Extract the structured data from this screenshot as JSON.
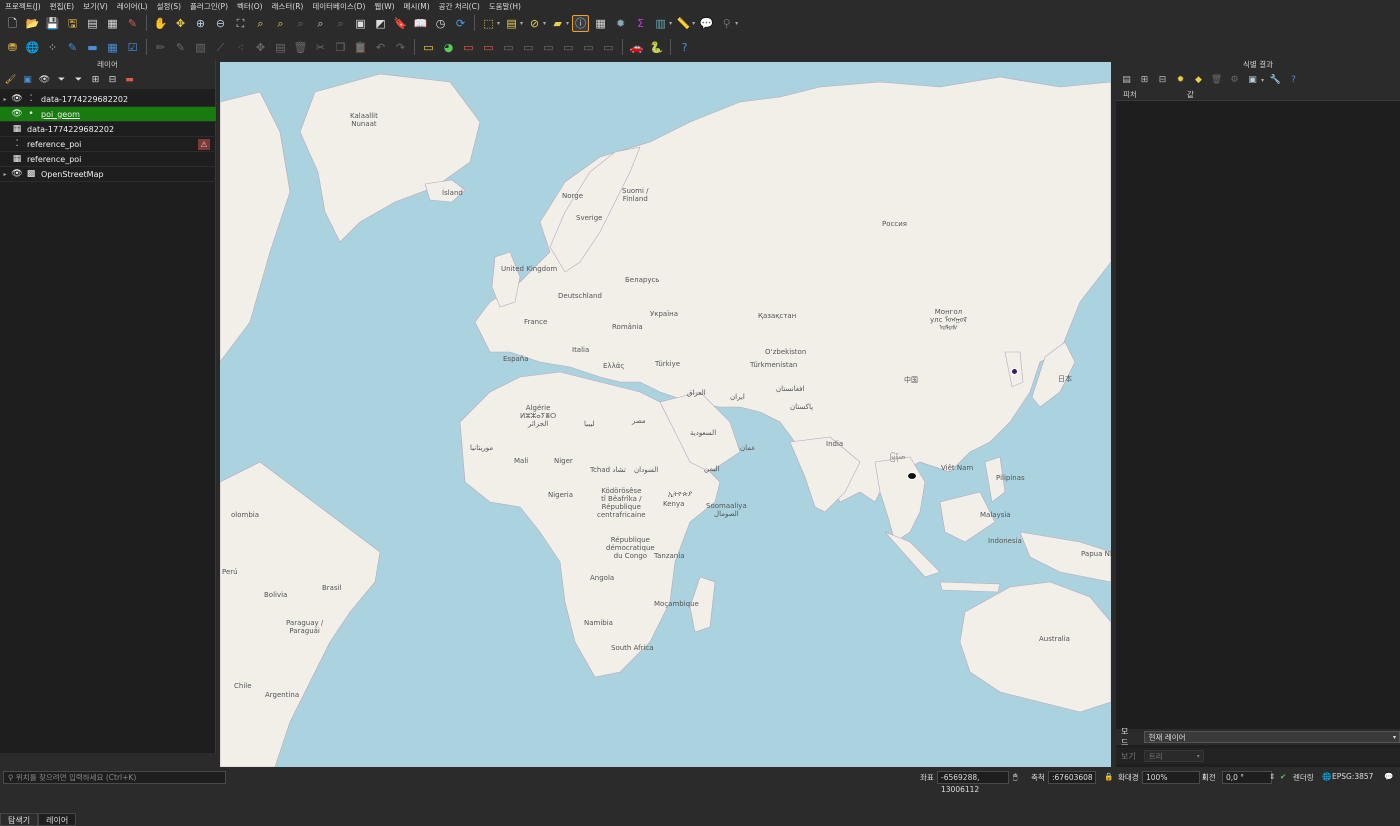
{
  "menu": [
    "프로젝트(J)",
    "편집(E)",
    "보기(V)",
    "레이어(L)",
    "설정(S)",
    "플러그인(P)",
    "벡터(O)",
    "래스터(R)",
    "데이터베이스(D)",
    "웹(W)",
    "메시(M)",
    "공간 처리(C)",
    "도움말(H)"
  ],
  "layers_panel": {
    "title": "레이어",
    "layers": [
      {
        "name": "data-1774229682202",
        "expandable": true,
        "visible": true,
        "icon": "points-icon",
        "selected": false,
        "warning": false
      },
      {
        "name": "poi_geom",
        "expandable": false,
        "visible": true,
        "icon": "point-icon",
        "selected": true,
        "warning": false
      },
      {
        "name": "data-1774229682202",
        "expandable": false,
        "visible": null,
        "icon": "table-icon",
        "selected": false,
        "warning": false
      },
      {
        "name": "reference_poi",
        "expandable": false,
        "visible": null,
        "icon": "points-icon",
        "selected": false,
        "warning": true
      },
      {
        "name": "reference_poi",
        "expandable": false,
        "visible": null,
        "icon": "table-icon",
        "selected": false,
        "warning": false
      },
      {
        "name": "OpenStreetMap",
        "expandable": true,
        "visible": true,
        "icon": "xyz-tiles-icon",
        "selected": false,
        "warning": false
      }
    ],
    "tabs": [
      "탐색기",
      "레이어"
    ],
    "active_tab": "레이어"
  },
  "map": {
    "labels": {
      "greenland": "Kalaallit\nNunaat",
      "iceland": "Ísland",
      "norway": "Norge",
      "sweden": "Sverige",
      "finland": "Suomi /\nFinland",
      "russia": "Россия",
      "uk": "United Kingdom",
      "belarus": "Беларусь",
      "germany": "Deutschland",
      "ukraine": "Україна",
      "france": "France",
      "romania": "România",
      "kazakhstan": "Қазақстан",
      "mongolia": "Монгол\nулс ᠮᠤᠩᠭᠤᠯ\nᠤᠯᠤᠰ",
      "spain": "España",
      "italy": "Italia",
      "greece": "Ελλάς",
      "turkey": "Türkiye",
      "uzbekistan": "O‘zbekiston",
      "turkmenistan": "Türkmenistan",
      "china": "中国",
      "japan": "日本",
      "iraq": "العراق",
      "iran": "ایران",
      "afghanistan": "افغانستان",
      "pakistan": "پاکستان",
      "algeria": "Algérie\nⵍⵣⵣⴰⵢⴻⵔ\nالجزائر",
      "libya": "ليبيا",
      "egypt": "مصر",
      "saudi": "السعودية",
      "oman": "عمان",
      "yemen": "اليمن",
      "india": "India",
      "myanmar": "မြန်မာ",
      "vietnam": "Việt Nam",
      "philippines": "Pilipinas",
      "mauritania": "موريتانيا",
      "mali": "Mali",
      "niger": "Niger",
      "chad": "Tchad تشاد",
      "sudan": "السودان",
      "ethiopia": "ኢትዮጵያ",
      "somalia": "Soomaaliya\nالصومال",
      "nigeria": "Nigeria",
      "car": "Ködörösêse\ntî Bêafrîka /\nRépublique\ncentrafricaine",
      "kenya": "Kenya",
      "drc": "République\ndémocratique\ndu Congo",
      "tanzania": "Tanzania",
      "malaysia": "Malaysia",
      "indonesia": "Indonesia",
      "png": "Papua Niugin",
      "angola": "Angola",
      "mozambique": "Moçambique",
      "namibia": "Namibia",
      "southafrica": "South Africa",
      "australia": "Australia",
      "colombia": "olombia",
      "peru": "Perú",
      "brasil": "Brasil",
      "bolivia": "Bolivia",
      "paraguay": "Paraguay /\nParaguái",
      "chile": "Chile",
      "argentina": "Argentina"
    }
  },
  "identify_panel": {
    "title": "식별 결과",
    "columns": [
      "피처",
      "값"
    ],
    "mode_label": "모드",
    "mode_value": "현재 레이어",
    "view_label": "보기",
    "view_value": "트리"
  },
  "status_bar": {
    "locator_placeholder": "위치를 찾으려면 입력하세요 (Ctrl+K)",
    "coord_label": "좌표",
    "coord_value": "-6569288, 13006112",
    "scale_label": "축척",
    "scale_value": ":67603608",
    "magnifier_label": "확대경",
    "magnifier_value": "100%",
    "rotation_label": "회전",
    "rotation_value": "0,0 °",
    "render_label": "렌더링",
    "crs": "EPSG:3857"
  },
  "colors": {
    "selection": "#177b0f",
    "sea": "#aad3df",
    "land": "#f2efe9",
    "point": "#3b1b6b"
  }
}
